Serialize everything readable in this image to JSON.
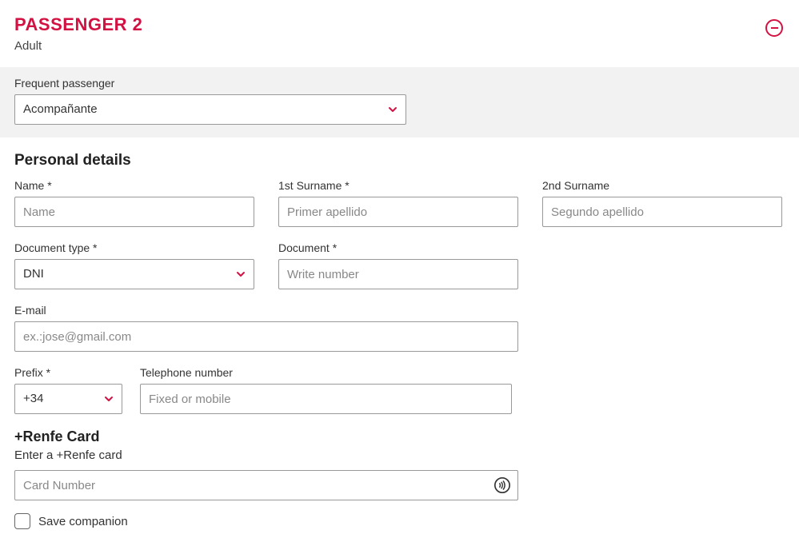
{
  "header": {
    "title": "PASSENGER 2",
    "subtitle": "Adult"
  },
  "frequent": {
    "label": "Frequent passenger",
    "value": "Acompañante"
  },
  "personal": {
    "section_title": "Personal details",
    "name_label": "Name *",
    "name_placeholder": "Name",
    "surname1_label": "1st Surname *",
    "surname1_placeholder": "Primer apellido",
    "surname2_label": "2nd Surname",
    "surname2_placeholder": "Segundo apellido",
    "doctype_label": "Document type *",
    "doctype_value": "DNI",
    "document_label": "Document *",
    "document_placeholder": "Write number",
    "email_label": "E-mail",
    "email_placeholder": "ex.:jose@gmail.com",
    "prefix_label": "Prefix *",
    "prefix_value": "+34",
    "phone_label": "Telephone number",
    "phone_placeholder": "Fixed or mobile"
  },
  "renfe": {
    "heading": "+Renfe Card",
    "subheading": "Enter a +Renfe card",
    "placeholder": "Card Number"
  },
  "save": {
    "label": "Save companion"
  },
  "colors": {
    "brand": "#d21242"
  }
}
